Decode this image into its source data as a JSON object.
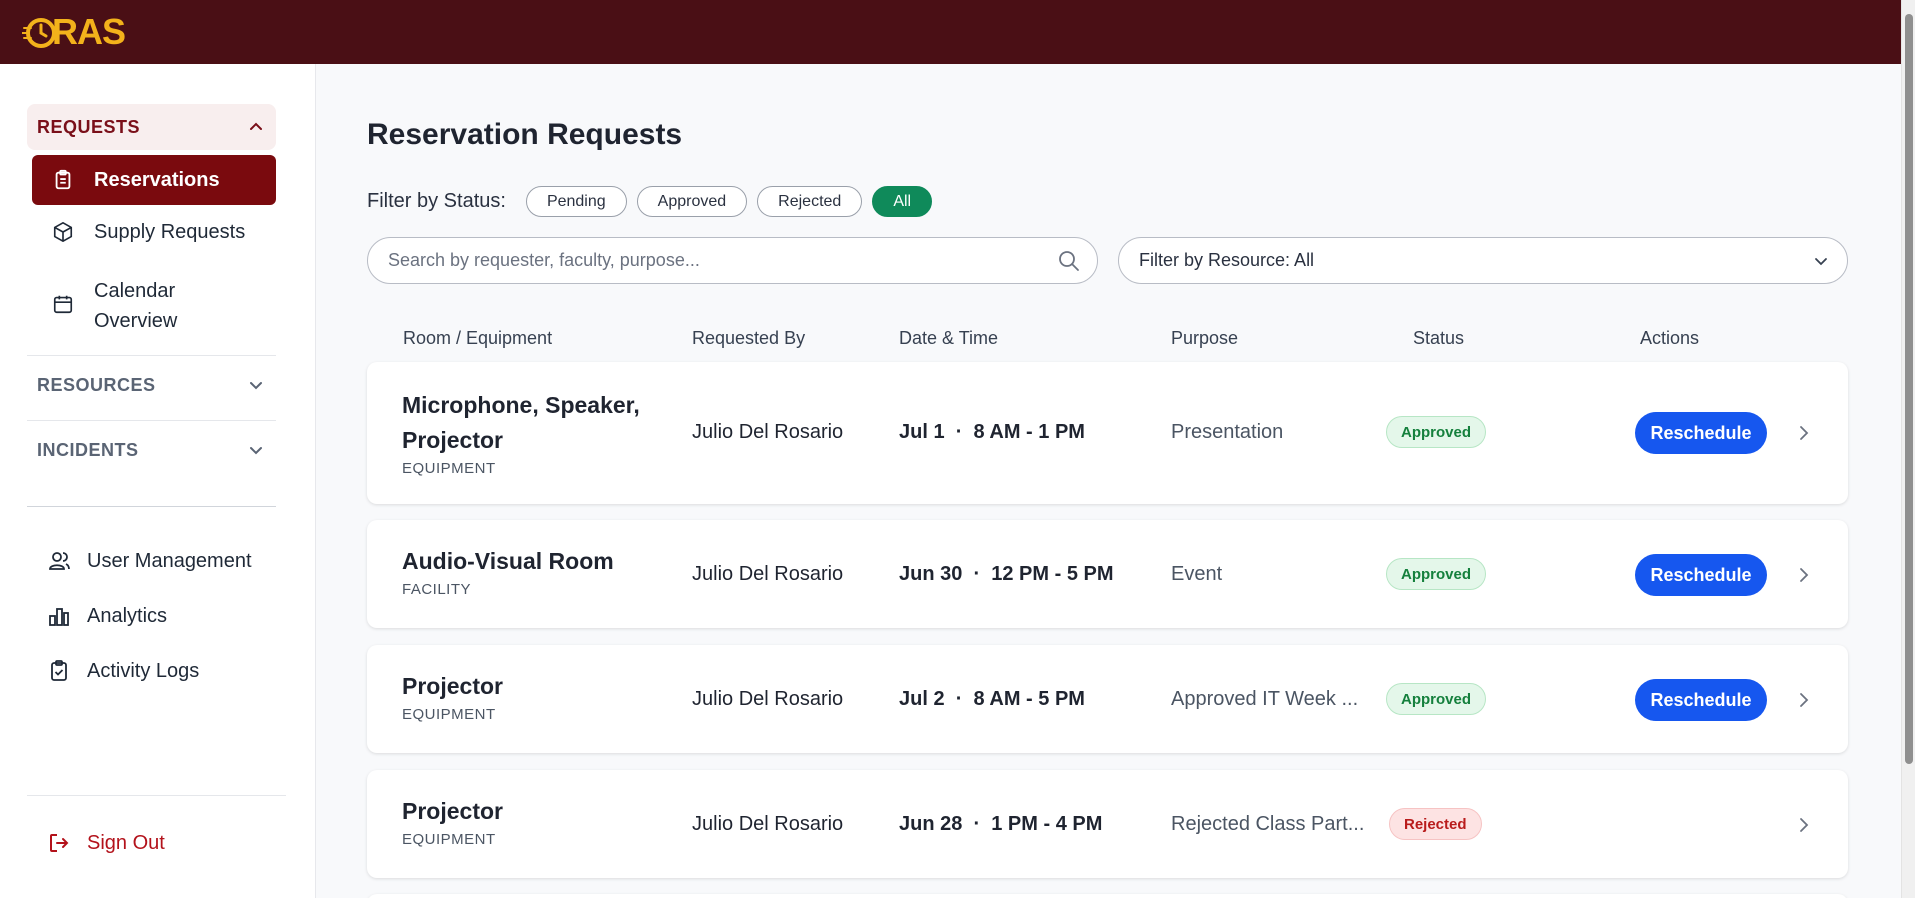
{
  "app": {
    "logo_text": "RAS",
    "colors": {
      "header": "#4a0f15",
      "accent": "#7a0a0e",
      "logo": "#f3b21b",
      "primary": "#1657ef",
      "success": "#0f8a5a"
    }
  },
  "sidebar": {
    "requests_label": "REQUESTS",
    "requests_items": [
      {
        "label": "Reservations",
        "icon": "clipboard-icon",
        "active": true
      },
      {
        "label": "Supply Requests",
        "icon": "box-icon"
      },
      {
        "label": "Calendar Overview",
        "icon": "calendar-icon"
      }
    ],
    "resources_label": "RESOURCES",
    "incidents_label": "INCIDENTS",
    "lower_items": [
      {
        "label": "User Management",
        "icon": "users-icon"
      },
      {
        "label": "Analytics",
        "icon": "bar-chart-icon"
      },
      {
        "label": "Activity Logs",
        "icon": "clipboard-check-icon"
      }
    ],
    "sign_out_label": "Sign Out"
  },
  "main": {
    "title": "Reservation Requests",
    "filter_label": "Filter by Status:",
    "status_filters": [
      "Pending",
      "Approved",
      "Rejected",
      "All"
    ],
    "active_filter": "All",
    "search_placeholder": "Search by requester, faculty, purpose...",
    "resource_filter": "Filter by Resource: All",
    "columns": [
      "Room / Equipment",
      "Requested By",
      "Date & Time",
      "Purpose",
      "Status",
      "Actions"
    ],
    "rows": [
      {
        "name": "Microphone, Speaker, Projector",
        "type": "EQUIPMENT",
        "requester": "Julio Del Rosario",
        "datetime": "Jul 1  ·  8 AM - 1 PM",
        "purpose": "Presentation",
        "status": "Approved",
        "action": "Reschedule"
      },
      {
        "name": "Audio-Visual Room",
        "type": "FACILITY",
        "requester": "Julio Del Rosario",
        "datetime": "Jun 30  ·  12 PM - 5 PM",
        "purpose": "Event",
        "status": "Approved",
        "action": "Reschedule"
      },
      {
        "name": "Projector",
        "type": "EQUIPMENT",
        "requester": "Julio Del Rosario",
        "datetime": "Jul 2  ·  8 AM - 5 PM",
        "purpose": "Approved IT Week ...",
        "status": "Approved",
        "action": "Reschedule"
      },
      {
        "name": "Projector",
        "type": "EQUIPMENT",
        "requester": "Julio Del Rosario",
        "datetime": "Jun 28  ·  1 PM - 4 PM",
        "purpose": "Rejected Class Part...",
        "status": "Rejected",
        "action": ""
      }
    ]
  }
}
